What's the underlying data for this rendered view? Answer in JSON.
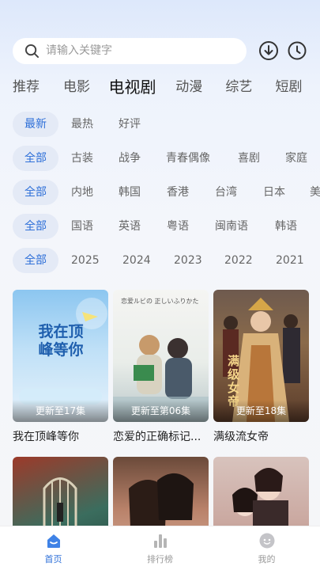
{
  "search": {
    "placeholder": "请输入关键字"
  },
  "icons": {
    "download": "download-icon",
    "history": "clock-icon",
    "search": "search-icon"
  },
  "colors": {
    "accent": "#2d6fd8",
    "chip_bg": "#e4eaf6"
  },
  "category_tabs": [
    "推荐",
    "电影",
    "电视剧",
    "动漫",
    "综艺",
    "短剧"
  ],
  "active_category": "电视剧",
  "filters": {
    "sort": [
      "最新",
      "最热",
      "好评"
    ],
    "genre": [
      "全部",
      "古装",
      "战争",
      "青春偶像",
      "喜剧",
      "家庭"
    ],
    "region": [
      "全部",
      "内地",
      "韩国",
      "香港",
      "台湾",
      "日本",
      "美"
    ],
    "language": [
      "全部",
      "国语",
      "英语",
      "粤语",
      "闽南语",
      "韩语"
    ],
    "year": [
      "全部",
      "2025",
      "2024",
      "2023",
      "2022",
      "2021"
    ]
  },
  "posters": [
    {
      "title": "我在顶峰等你",
      "badge": "更新至17集",
      "cover_text": "我在顶峰等你"
    },
    {
      "title": "恋爱的正确标记...",
      "badge": "更新至第06集",
      "cover_text": "恋爱ルビの 正しいふりかた"
    },
    {
      "title": "满级流女帝",
      "badge": "更新至18集",
      "cover_text": "满级女帝"
    },
    {
      "title": "",
      "badge": "",
      "cover_text": ""
    },
    {
      "title": "",
      "badge": "",
      "cover_text": ""
    },
    {
      "title": "",
      "badge": "",
      "cover_text": ""
    }
  ],
  "bottom_nav": [
    {
      "label": "首页",
      "icon": "home-icon",
      "active": true
    },
    {
      "label": "排行榜",
      "icon": "bar-chart-icon",
      "active": false
    },
    {
      "label": "我的",
      "icon": "profile-icon",
      "active": false
    }
  ]
}
